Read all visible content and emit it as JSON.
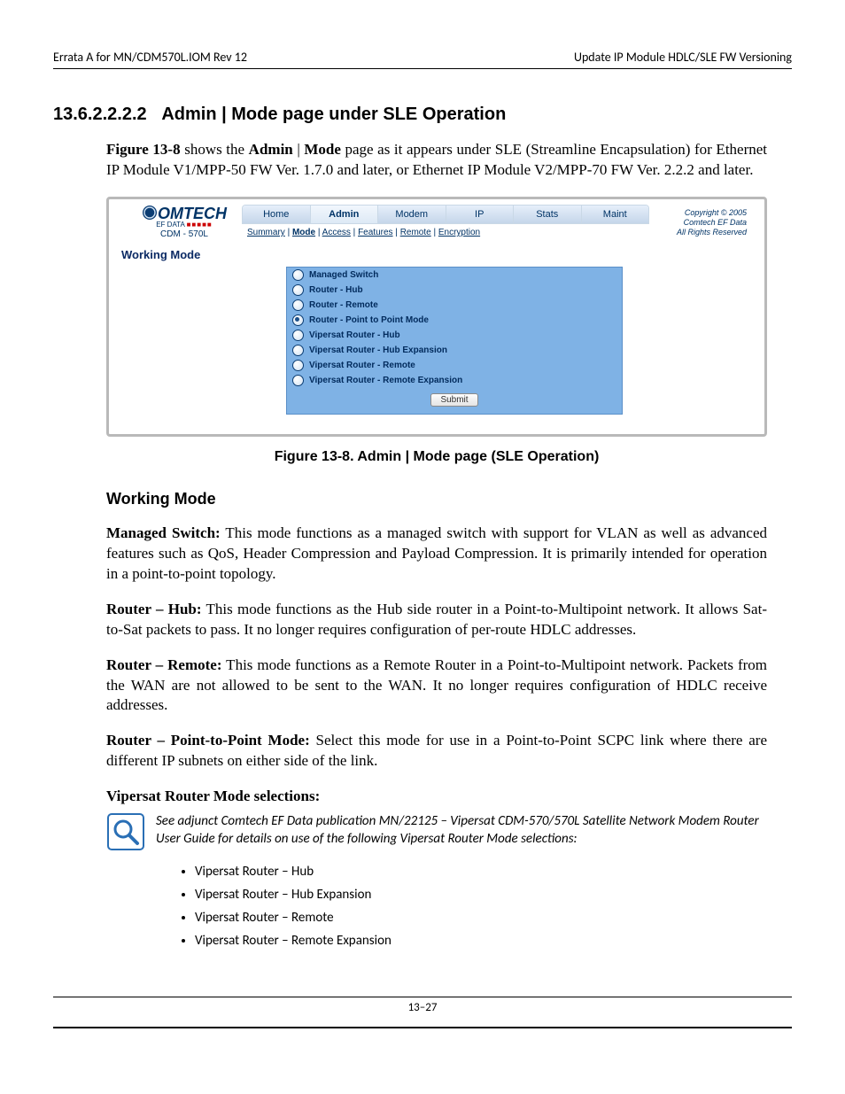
{
  "header": {
    "left": "Errata A for MN/CDM570L.IOM Rev 12",
    "right": "Update IP Module HDLC/SLE FW Versioning"
  },
  "section": {
    "number": "13.6.2.2.2.2",
    "title": "Admin | Mode page under SLE Operation"
  },
  "figureIntro": {
    "pre": "Figure 13-8",
    "mid1": " shows the ",
    "boldA": "Admin",
    "pipe": " | ",
    "boldB": "Mode",
    "rest": " page as it appears under SLE (Streamline Encapsulation) for Ethernet IP Module V1/MPP-50 FW Ver. 1.7.0 and later, or Ethernet IP Module V2/MPP-70 FW Ver. 2.2.2 and later."
  },
  "shot": {
    "logo": {
      "brand": "OMTECH",
      "sub1a": "EF DATA ",
      "sub1b": "■■■■■",
      "model": "CDM - 570L"
    },
    "tabs": [
      "Home",
      "Admin",
      "Modem",
      "IP",
      "Stats",
      "Maint"
    ],
    "activeTab": 1,
    "subtabs": [
      "Summary",
      "Mode",
      "Access",
      "Features",
      "Remote",
      "Encryption"
    ],
    "activeSub": 1,
    "copyright": [
      "Copyright © 2005",
      "Comtech EF Data",
      "All Rights Reserved"
    ],
    "sectionLabel": "Working Mode",
    "options": [
      "Managed Switch",
      "Router - Hub",
      "Router - Remote",
      "Router - Point to Point Mode",
      "Vipersat Router - Hub",
      "Vipersat Router - Hub Expansion",
      "Vipersat Router - Remote",
      "Vipersat Router - Remote Expansion"
    ],
    "selected": 3,
    "submit": "Submit"
  },
  "figureCaption": "Figure 13-8. Admin | Mode page (SLE Operation)",
  "workingModeHeading": "Working Mode",
  "modes": {
    "m1": {
      "label": "Managed Switch:",
      "text": " This mode functions as a managed switch with support for VLAN as well as advanced features such as QoS, Header Compression and Payload Compression. It is primarily intended for operation in a point-to-point topology."
    },
    "m2": {
      "label": "Router – Hub:",
      "text": " This mode functions as the Hub side router in a Point-to-Multipoint network. It allows Sat-to-Sat packets to pass. It no longer requires configuration of per-route HDLC addresses."
    },
    "m3": {
      "label": "Router – Remote:",
      "text": " This mode functions as a Remote Router in a Point-to-Multipoint network. Packets from the WAN are not allowed to be sent to the WAN. It no longer requires configuration of HDLC receive addresses."
    },
    "m4": {
      "label": "Router – Point-to-Point Mode:",
      "text": " Select this mode for use in a Point-to-Point SCPC link where there are different IP subnets on either side of the link."
    }
  },
  "vipersatHeading": "Vipersat Router Mode selections:",
  "noteText": "See adjunct Comtech EF Data publication MN/22125 – Vipersat CDM-570/570L Satellite Network Modem Router User Guide for details on use of the following Vipersat Router Mode selections:",
  "vlist": [
    "Vipersat Router – Hub",
    "Vipersat Router – Hub Expansion",
    "Vipersat Router – Remote",
    "Vipersat Router – Remote Expansion"
  ],
  "pageNum": "13–27"
}
